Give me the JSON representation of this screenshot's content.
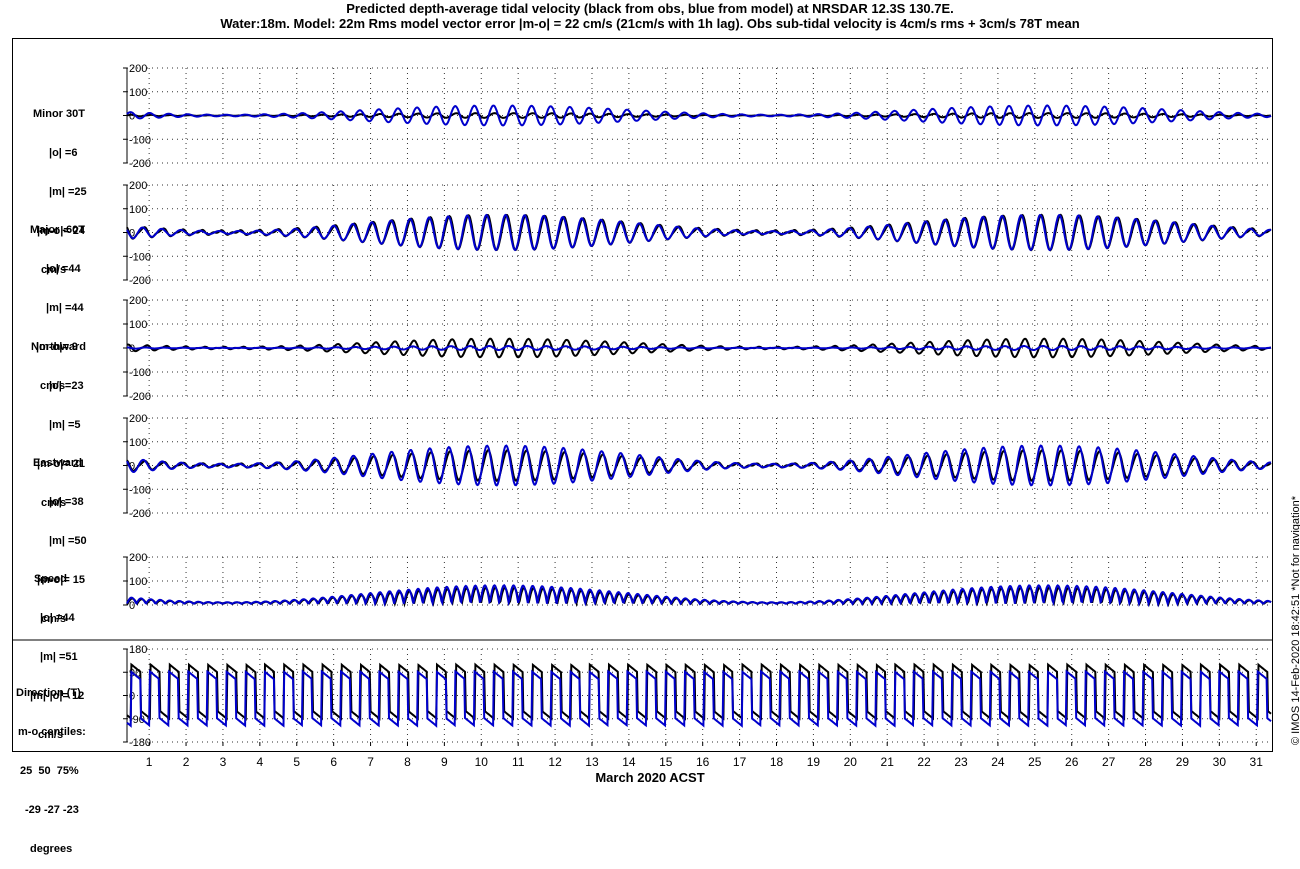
{
  "title_line1": "Predicted depth-average tidal velocity (black from obs, blue from model) at NRSDAR 12.3S 130.7E.",
  "title_line2": "Water:18m. Model: 22m  Rms model vector error |m-o| = 22 cm/s (21cm/s with 1h lag). Obs sub-tidal velocity is 4cm/s rms + 3cm/s 78T mean",
  "x_axis_label": "March 2020 ACST",
  "credit": "© IMOS 14-Feb-2020 18:42:51  *Not for navigation*",
  "colors": {
    "obs": "#000000",
    "model": "#0000cc",
    "grid": "#000000"
  },
  "chart_data": [
    {
      "type": "line",
      "name": "minor",
      "label_lines": [
        "Minor 30T",
        "|o| =6",
        "|m| =25",
        "|m-o|= 24",
        "cm/s"
      ],
      "ylim": [
        -200,
        200
      ],
      "yticks": [
        "200",
        "100",
        "0",
        "-100",
        "-200"
      ],
      "xlim": [
        0.4,
        31.4
      ],
      "xticks": [
        "1",
        "2",
        "3",
        "4",
        "5",
        "6",
        "7",
        "8",
        "9",
        "10",
        "11",
        "12",
        "13",
        "14",
        "15",
        "16",
        "17",
        "18",
        "19",
        "20",
        "21",
        "22",
        "23",
        "24",
        "25",
        "26",
        "27",
        "28",
        "29",
        "30",
        "31"
      ],
      "series": [
        {
          "amplitude": 6
        },
        {
          "amplitude": 25
        }
      ]
    },
    {
      "type": "line",
      "name": "major",
      "label_lines": [
        "Major -60T",
        "|o| =44",
        "|m| =44",
        "|m-o|= 9",
        "cm/s"
      ],
      "ylim": [
        -200,
        200
      ],
      "yticks": [
        "200",
        "100",
        "0",
        "-100",
        "-200"
      ],
      "xlim": [
        0.4,
        31.4
      ],
      "series": [
        {
          "amplitude": 44
        },
        {
          "amplitude": 44
        }
      ]
    },
    {
      "type": "line",
      "name": "northward",
      "label_lines": [
        "Northward",
        "|o| =23",
        "|m| =5",
        "|m-o|= 21",
        "cm/s"
      ],
      "ylim": [
        -200,
        200
      ],
      "yticks": [
        "200",
        "100",
        "0",
        "-100",
        "-200"
      ],
      "xlim": [
        0.4,
        31.4
      ],
      "series": [
        {
          "amplitude": 23
        },
        {
          "amplitude": 5
        }
      ]
    },
    {
      "type": "line",
      "name": "eastward",
      "label_lines": [
        "Eastward",
        "|o| =38",
        "|m| =50",
        "|m-o|= 15",
        "cm/s"
      ],
      "ylim": [
        -200,
        200
      ],
      "yticks": [
        "200",
        "100",
        "0",
        "-100",
        "-200"
      ],
      "xlim": [
        0.4,
        31.4
      ],
      "series": [
        {
          "amplitude": 38
        },
        {
          "amplitude": 50
        }
      ]
    },
    {
      "type": "line",
      "name": "speed",
      "label_lines": [
        "Speed",
        "|o| =44",
        "|m| =51",
        "|m|-|o|= 12",
        "cm/s"
      ],
      "ylim": [
        0,
        200
      ],
      "yticks": [
        "200",
        "100",
        "0"
      ],
      "xlim": [
        0.4,
        31.4
      ],
      "series": [
        {
          "amplitude": 44
        },
        {
          "amplitude": 51
        }
      ]
    },
    {
      "type": "line",
      "name": "direction",
      "label_lines": [
        "Direction (T)",
        "m-o centiles:",
        "25  50  75%",
        "-29 -27 -23",
        "degrees"
      ],
      "ylim": [
        -180,
        180
      ],
      "yticks": [
        "180",
        "90",
        "0",
        "-90",
        "-180"
      ],
      "xlim": [
        0.4,
        31.4
      ],
      "centiles": [
        -29,
        -27,
        -23
      ]
    }
  ]
}
